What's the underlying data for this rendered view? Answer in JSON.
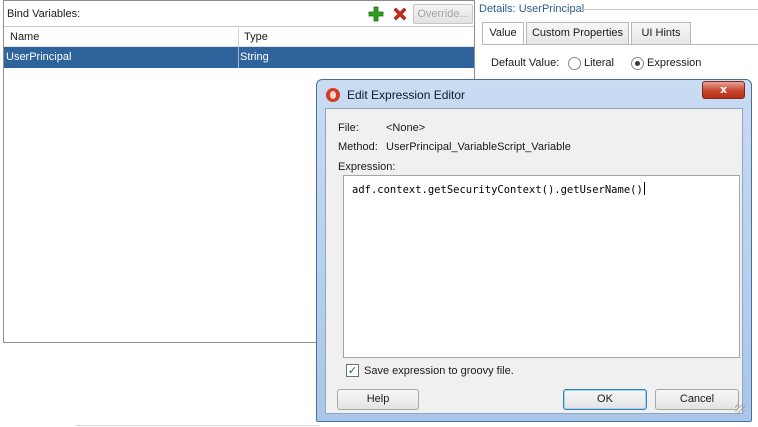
{
  "bind_variables": {
    "title": "Bind Variables:",
    "add_icon": "plus-icon",
    "delete_icon": "x-icon",
    "override_label": "Override...",
    "columns": [
      "Name",
      "Type"
    ],
    "rows": [
      {
        "name": "UserPrincipal",
        "type": "String"
      }
    ]
  },
  "details": {
    "title": "Details: UserPrincipal",
    "tabs": [
      "Value",
      "Custom Properties",
      "UI Hints"
    ],
    "active_tab": "Value",
    "default_value_label": "Default Value:",
    "options": [
      "Literal",
      "Expression"
    ],
    "selected_option": "Expression"
  },
  "dialog": {
    "title": "Edit Expression Editor",
    "close_label": "x",
    "file_label": "File:",
    "file_value": "<None>",
    "method_label": "Method:",
    "method_value": "UserPrincipal_VariableScript_Variable",
    "expression_label": "Expression:",
    "expression_value": "adf.context.getSecurityContext().getUserName()",
    "save_checkbox_label": "Save expression to groovy file.",
    "save_checked": true,
    "help_label": "Help",
    "ok_label": "OK",
    "cancel_label": "Cancel"
  },
  "colors": {
    "selection": "#2e639c",
    "details_title": "#2c5c96",
    "add_icon": "#2e9e1f",
    "delete_icon": "#d0281b"
  }
}
